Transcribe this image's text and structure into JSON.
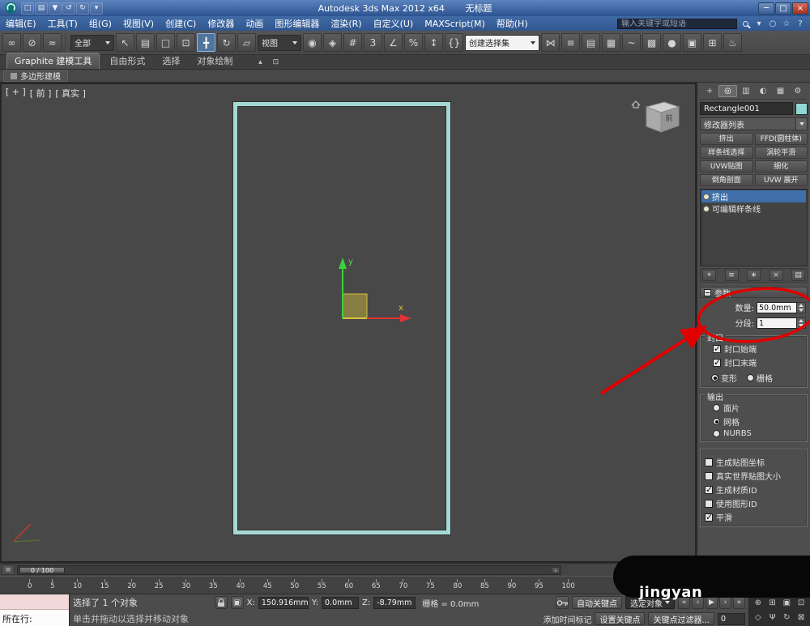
{
  "colors": {
    "titlebar_blue": "#3b66a0",
    "accent_blue": "#3f6ea8",
    "spline_cyan": "#a6d8d5",
    "annotation_red": "#e10000",
    "viewport_gray": "#484848",
    "object_color": "#8fd8d4"
  },
  "window": {
    "app_title": "Autodesk 3ds Max 2012 x64",
    "doc_title": "无标题",
    "quick_access": [
      {
        "n": "new-scene-icon",
        "g": "□"
      },
      {
        "n": "open-file-icon",
        "g": "▤"
      },
      {
        "n": "save-file-icon",
        "g": "▼"
      },
      {
        "n": "undo-icon",
        "g": "↺"
      },
      {
        "n": "redo-icon",
        "g": "↻"
      },
      {
        "n": "workspace-dropdown-icon",
        "g": "▾"
      }
    ],
    "controls": {
      "min": "─",
      "max": "□",
      "close": "×"
    }
  },
  "menubar": {
    "items": [
      "编辑(E)",
      "工具(T)",
      "组(G)",
      "视图(V)",
      "创建(C)",
      "修改器",
      "动画",
      "图形编辑器",
      "渲染(R)",
      "自定义(U)",
      "MAXScript(M)",
      "帮助(H)"
    ],
    "search_placeholder": "输入关键字或短语",
    "right_icons": [
      {
        "n": "search-history-dropdown-icon",
        "g": "▾"
      },
      {
        "n": "communication-center-icon",
        "g": "○"
      },
      {
        "n": "favorites-icon",
        "g": "☆"
      },
      {
        "n": "help-icon",
        "g": "?"
      }
    ]
  },
  "toolbar": {
    "group1": [
      {
        "n": "select-and-link-icon",
        "g": "∞"
      },
      {
        "n": "unlink-selection-icon",
        "g": "⊘"
      },
      {
        "n": "bind-to-space-warp-icon",
        "g": "≈"
      }
    ],
    "filter_dd": "全部",
    "group2": [
      {
        "n": "select-object-icon",
        "g": "↖"
      },
      {
        "n": "select-by-name-icon",
        "g": "▤"
      },
      {
        "n": "rectangular-selection-icon",
        "g": "□"
      },
      {
        "n": "window-crossing-icon",
        "g": "⊡"
      },
      {
        "n": "select-and-move-icon",
        "g": "╋",
        "on": true
      },
      {
        "n": "select-and-rotate-icon",
        "g": "↻"
      },
      {
        "n": "select-and-scale-icon",
        "g": "▱"
      }
    ],
    "coord_dd": "视图",
    "group3": [
      {
        "n": "use-pivot-center-icon",
        "g": "◉"
      },
      {
        "n": "select-and-manipulate-icon",
        "g": "◈"
      },
      {
        "n": "keyboard-override-icon",
        "g": "#"
      },
      {
        "n": "snaps-toggle-icon",
        "g": "3"
      },
      {
        "n": "angle-snap-icon",
        "g": "∠"
      },
      {
        "n": "percent-snap-icon",
        "g": "%"
      },
      {
        "n": "spinner-snap-icon",
        "g": "↕"
      },
      {
        "n": "named-selection-sets-icon",
        "g": "{}"
      }
    ],
    "selset_dd": "创建选择集",
    "group4": [
      {
        "n": "mirror-icon",
        "g": "⋈"
      },
      {
        "n": "align-icon",
        "g": "≡"
      },
      {
        "n": "layer-manager-icon",
        "g": "▤"
      },
      {
        "n": "ribbon-toggle-icon",
        "g": "▦"
      },
      {
        "n": "curve-editor-icon",
        "g": "~"
      },
      {
        "n": "schematic-view-icon",
        "g": "▩"
      },
      {
        "n": "material-editor-icon",
        "g": "●"
      },
      {
        "n": "render-setup-icon",
        "g": "▣"
      },
      {
        "n": "rendered-frame-icon",
        "g": "⊞"
      },
      {
        "n": "render-production-icon",
        "g": "♨"
      }
    ]
  },
  "ribbon": {
    "tabs": [
      {
        "label": "Graphite 建模工具",
        "on": true
      },
      {
        "label": "自由形式"
      },
      {
        "label": "选择"
      },
      {
        "label": "对象绘制"
      }
    ],
    "right_icons": [
      {
        "n": "minimize-ribbon-icon",
        "g": "▴"
      },
      {
        "n": "ribbon-config-icon",
        "g": "⊡"
      }
    ],
    "subtab": "多边形建模"
  },
  "viewport": {
    "labels": [
      "[ + ]",
      "[ 前 ]",
      "[ 真实 ]"
    ],
    "viewcube_front": "前",
    "axis_x": "x",
    "axis_y": "y"
  },
  "timeline": {
    "left_icon": "≡",
    "slider_label": "0 / 100",
    "next_arrow": "›",
    "ticks": [
      "0",
      "5",
      "10",
      "15",
      "20",
      "25",
      "30",
      "35",
      "40",
      "45",
      "50",
      "55",
      "60",
      "65",
      "70",
      "75",
      "80",
      "85",
      "90",
      "95",
      "100"
    ]
  },
  "panel": {
    "tabs": [
      {
        "n": "create-tab-icon",
        "g": "+"
      },
      {
        "n": "modify-tab-icon",
        "g": "◎",
        "on": true
      },
      {
        "n": "hierarchy-tab-icon",
        "g": "▥"
      },
      {
        "n": "motion-tab-icon",
        "g": "◐"
      },
      {
        "n": "display-tab-icon",
        "g": "▦"
      },
      {
        "n": "utilities-tab-icon",
        "g": "⚙"
      }
    ],
    "object_name": "Rectangle001",
    "modifier_list_label": "修改器列表",
    "modifier_buttons": [
      "挤出",
      "FFD(圆柱体)",
      "样条线选择",
      "涡轮平滑",
      "UVW贴图",
      "细化",
      "倒角剖面",
      "UVW 展开"
    ],
    "stack": [
      {
        "label": "挤出",
        "on": true
      },
      {
        "label": "可编辑样条线"
      }
    ],
    "stack_tools": [
      {
        "n": "pin-stack-icon",
        "g": "⌖"
      },
      {
        "n": "show-end-result-icon",
        "g": "≡"
      },
      {
        "n": "make-unique-icon",
        "g": "∗"
      },
      {
        "n": "remove-modifier-icon",
        "g": "×"
      },
      {
        "n": "configure-modifier-sets-icon",
        "g": "▤"
      }
    ],
    "params": {
      "title": "参数",
      "amount_label": "数量:",
      "amount_value": "50.0mm",
      "segments_label": "分段:",
      "segments_value": "1"
    },
    "cap": {
      "title": "封口",
      "checks": [
        {
          "label": "封口始端",
          "on": true
        },
        {
          "label": "封口末端",
          "on": true
        }
      ],
      "radios": [
        {
          "label": "变形",
          "on": true
        },
        {
          "label": "栅格"
        }
      ]
    },
    "output": {
      "title": "输出",
      "radios": [
        {
          "label": "面片"
        },
        {
          "label": "网格",
          "on": true
        },
        {
          "label": "NURBS"
        }
      ]
    },
    "options": [
      {
        "label": "生成贴图坐标"
      },
      {
        "label": "真实世界贴图大小"
      },
      {
        "label": "生成材质ID",
        "on": true
      },
      {
        "label": "使用图形ID"
      },
      {
        "label": "平滑",
        "on": true
      }
    ]
  },
  "statusbar": {
    "listener_label": "所在行:",
    "selection_status": "选择了 1 个对象",
    "prompt": "单击并拖动以选择并移动对象",
    "add_time_tag": "添加时间标记",
    "abs_mode_glyph": "▣",
    "coords": {
      "x_label": "X:",
      "x": "150.916mm",
      "y_label": "Y:",
      "y": "0.0mm",
      "z_label": "Z:",
      "z": "-8.79mm"
    },
    "grid_label": "栅格 = 0.0mm",
    "auto_key": "自动关键点",
    "selected_filter": "选定对象",
    "set_key": "设置关键点",
    "key_filters": "关键点过滤器...",
    "time_value": "0",
    "playback": [
      {
        "n": "go-to-start-icon",
        "g": "«"
      },
      {
        "n": "previous-frame-icon",
        "g": "‹"
      },
      {
        "n": "play-animation-icon",
        "g": "▶"
      },
      {
        "n": "next-frame-icon",
        "g": "›"
      },
      {
        "n": "go-to-end-icon",
        "g": "»"
      }
    ],
    "nav": [
      {
        "n": "zoom-icon",
        "g": "⊕"
      },
      {
        "n": "zoom-all-icon",
        "g": "⊞"
      },
      {
        "n": "zoom-extents-icon",
        "g": "▣"
      },
      {
        "n": "zoom-region-icon",
        "g": "⊡"
      },
      {
        "n": "fov-icon",
        "g": "◇"
      },
      {
        "n": "pan-icon",
        "g": "Ψ"
      },
      {
        "n": "orbit-icon",
        "g": "↻"
      },
      {
        "n": "maximize-viewport-icon",
        "g": "⊠"
      }
    ]
  },
  "annotation": {
    "color": "#e10000"
  },
  "watermark": {
    "text": "jingyan"
  }
}
